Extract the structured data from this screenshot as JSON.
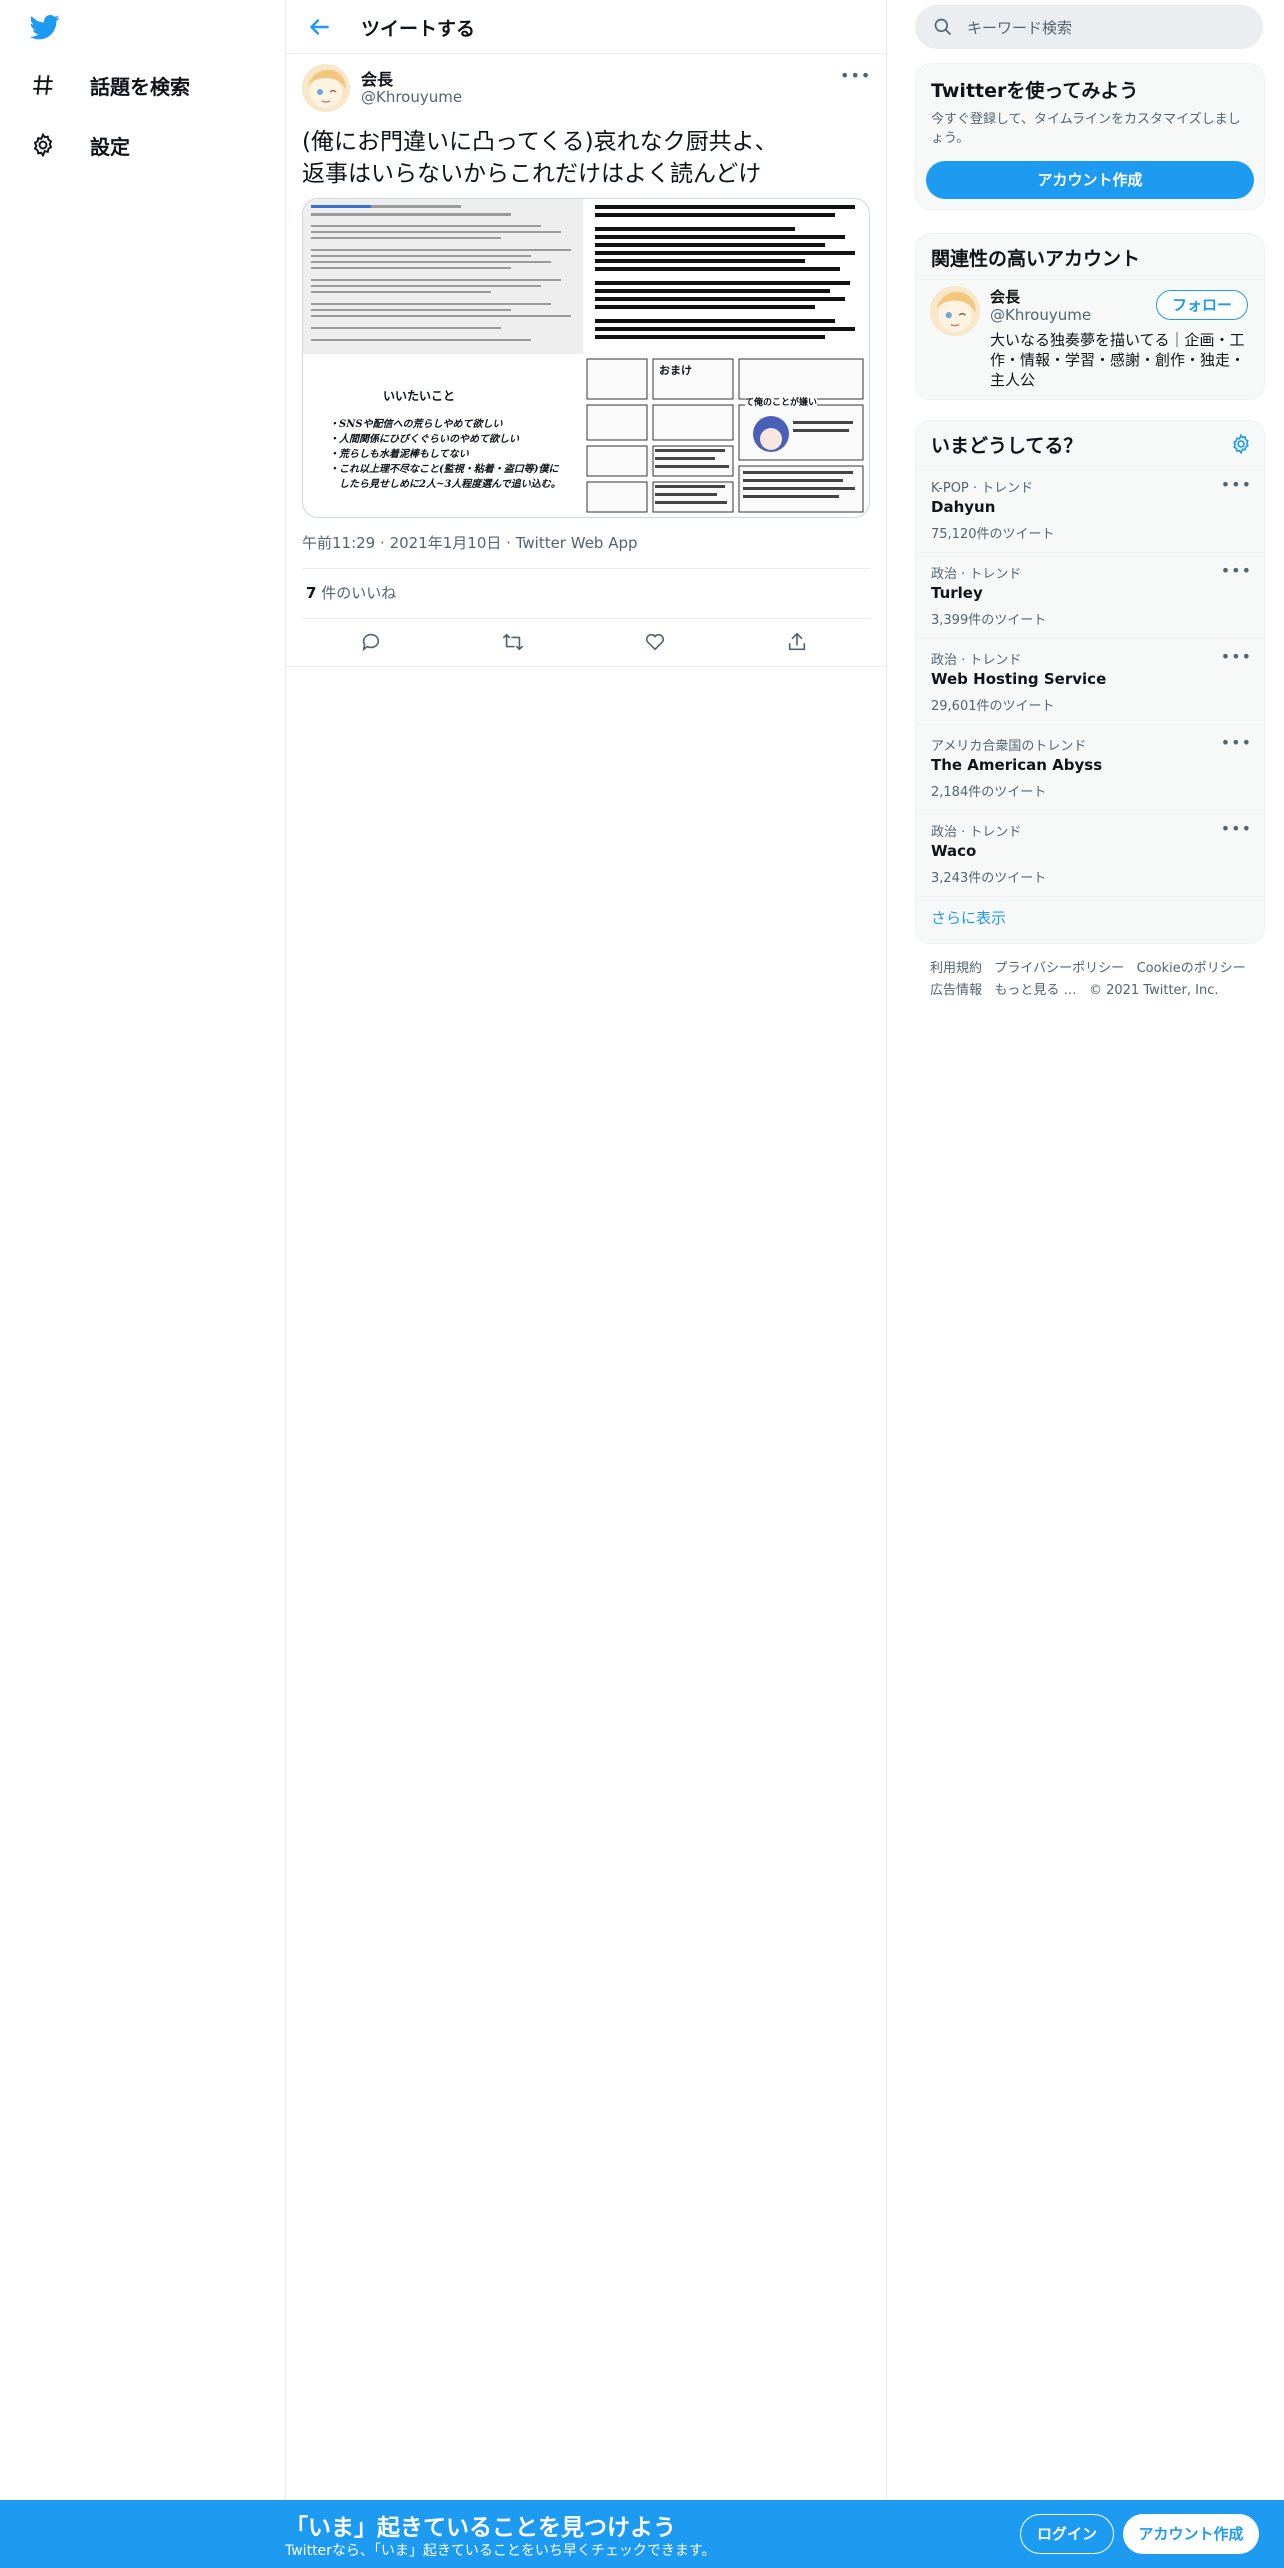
{
  "nav": {
    "explore_label": "話題を検索",
    "settings_label": "設定"
  },
  "header": {
    "title": "ツイートする"
  },
  "tweet": {
    "author_name": "会長",
    "author_handle": "@Khrouyume",
    "text": "(俺にお門違いに凸ってくる)哀れなク厨共よ、\n返事はいらないからこれだけはよく読んどけ",
    "media": {
      "left_heading": "いいたいこと",
      "left_points": [
        "・SNSや配信への荒らしやめて欲しい",
        "・人間関係にひびくぐらいのやめて欲しい",
        "・荒らしも水着泥棒もしてない",
        "・これ以上理不尽なこと(監視・粘着・盗口等)僕に",
        "　したら見せしめに2人~3人程度選んで追い込む。"
      ],
      "right_heading": "おまけ",
      "right_caption": "て俺のことが嫌い"
    },
    "time": "午前11:29",
    "date": "2021年1月10日",
    "source": "Twitter Web App",
    "likes_count": "7",
    "likes_label": "件のいいね"
  },
  "right": {
    "search_placeholder": "キーワード検索",
    "signup_card": {
      "title": "Twitterを使ってみよう",
      "desc": "今すぐ登録して、タイムラインをカスタマイズしましょう。",
      "button": "アカウント作成"
    },
    "related": {
      "title": "関連性の高いアカウント",
      "name": "会長",
      "handle": "@Khrouyume",
      "follow": "フォロー",
      "bio": "大いなる独奏夢を描いてる｜企画・工作・情報・学習・感謝・創作・独走・主人公"
    },
    "trends": {
      "title": "いまどうしてる？",
      "items": [
        {
          "category": "K-POP · トレンド",
          "name": "Dahyun",
          "count": "75,120件のツイート"
        },
        {
          "category": "政治 · トレンド",
          "name": "Turley",
          "count": "3,399件のツイート"
        },
        {
          "category": "政治 · トレンド",
          "name": "Web Hosting Service",
          "count": "29,601件のツイート"
        },
        {
          "category": "アメリカ合衆国のトレンド",
          "name": "The American Abyss",
          "count": "2,184件のツイート"
        },
        {
          "category": "政治 · トレンド",
          "name": "Waco",
          "count": "3,243件のツイート"
        }
      ],
      "more": "さらに表示"
    },
    "footer": {
      "terms": "利用規約",
      "privacy": "プライバシーポリシー",
      "cookie": "Cookieのポリシー",
      "ads": "広告情報",
      "more": "もっと見る …",
      "copyright": "© 2021 Twitter, Inc."
    }
  },
  "banner": {
    "headline": "「いま」起きていることを見つけよう",
    "sub": "Twitterなら、「いま」起きていることをいち早くチェックできます。",
    "login": "ログイン",
    "signup": "アカウント作成"
  },
  "colors": {
    "brand": "#1d9bf0",
    "text": "#0f1419",
    "muted": "#536471"
  }
}
